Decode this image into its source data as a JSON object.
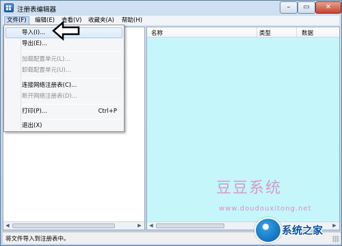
{
  "window": {
    "title": "注册表编辑器"
  },
  "menubar": {
    "items": [
      {
        "label": "文件(F)"
      },
      {
        "label": "编辑(E)"
      },
      {
        "label": "查看(V)"
      },
      {
        "label": "收藏夹(A)"
      },
      {
        "label": "帮助(H)"
      }
    ]
  },
  "file_menu": {
    "items": [
      {
        "label": "导入(I)...",
        "shortcut": "",
        "enabled": true,
        "highlighted": true
      },
      {
        "label": "导出(E)...",
        "shortcut": "",
        "enabled": true
      },
      {
        "label": "加载配置单元(L)...",
        "shortcut": "",
        "enabled": false
      },
      {
        "label": "卸载配置单元(U)...",
        "shortcut": "",
        "enabled": false
      },
      {
        "label": "连接网络注册表(C)...",
        "shortcut": "",
        "enabled": true
      },
      {
        "label": "断开网络注册表(D)...",
        "shortcut": "",
        "enabled": false
      },
      {
        "label": "打印(P)...",
        "shortcut": "Ctrl+P",
        "enabled": true
      },
      {
        "label": "退出(X)",
        "shortcut": "",
        "enabled": true
      }
    ]
  },
  "list": {
    "columns": [
      {
        "label": "名称"
      },
      {
        "label": "类型"
      },
      {
        "label": "数据"
      }
    ]
  },
  "statusbar": {
    "text": "将文件导入到注册表中。"
  },
  "watermark": {
    "text": "豆豆系统",
    "url": "www.doudouxitong.net"
  },
  "logo": {
    "text": "系统之家"
  },
  "colors": {
    "list_bg": "#c5f6fa",
    "menu_highlight": "#dbe9f9",
    "watermark": "#d98fc4"
  }
}
